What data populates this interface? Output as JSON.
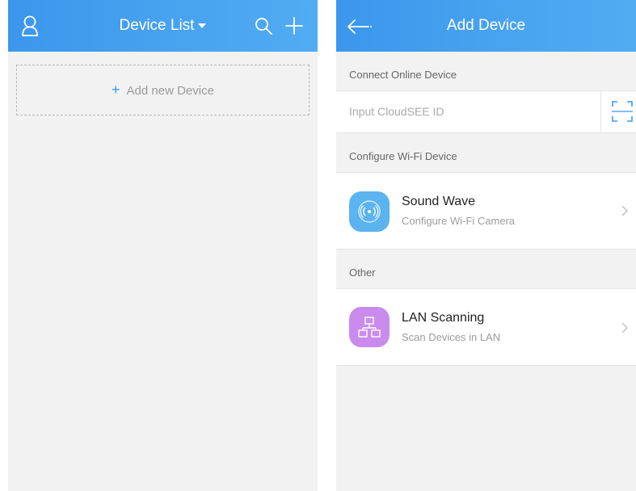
{
  "left_screen": {
    "title": "Device List",
    "add_new_label": "Add new Device",
    "icons": {
      "profile": "user-icon",
      "dropdown": "caret-down-icon",
      "search": "search-icon",
      "add": "plus-icon"
    }
  },
  "right_screen": {
    "title": "Add Device",
    "sections": {
      "online": {
        "header": "Connect Online Device",
        "input_placeholder": "Input CloudSEE ID",
        "input_value": ""
      },
      "wifi": {
        "header": "Configure Wi-Fi Device",
        "item": {
          "title": "Sound Wave",
          "subtitle": "Configure Wi-Fi Camera"
        }
      },
      "other": {
        "header": "Other",
        "item": {
          "title": "LAN Scanning",
          "subtitle": "Scan Devices in LAN"
        }
      }
    },
    "icons": {
      "back": "back-arrow-icon",
      "scan": "scan-frame-icon",
      "sound_wave": "sound-wave-icon",
      "lan": "network-icon",
      "chevron": "chevron-right-icon"
    }
  },
  "colors": {
    "nav_bar": "#3b97ec",
    "sound_wave_icon_bg": "#5bb3ef",
    "lan_icon_bg": "#c98cec",
    "page_bg": "#f2f2f2"
  }
}
